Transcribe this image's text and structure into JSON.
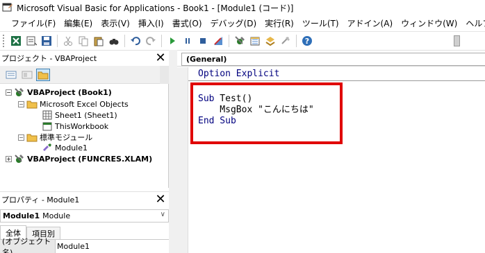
{
  "window": {
    "title": "Microsoft Visual Basic for Applications - Book1 - [Module1 (コード)]"
  },
  "menu": {
    "items": [
      "ファイル(F)",
      "編集(E)",
      "表示(V)",
      "挿入(I)",
      "書式(O)",
      "デバッグ(D)",
      "実行(R)",
      "ツール(T)",
      "アドイン(A)",
      "ウィンドウ(W)",
      "ヘルプ(H)"
    ]
  },
  "toolbar": {
    "icons": [
      "excel-view-icon",
      "insert-module-icon",
      "save-icon",
      "cut-icon",
      "copy-icon",
      "paste-icon",
      "find-icon",
      "undo-icon",
      "redo-icon",
      "run-icon",
      "break-icon",
      "reset-icon",
      "design-mode-icon",
      "project-explorer-icon",
      "properties-icon",
      "object-browser-icon",
      "toolbox-icon",
      "help-icon"
    ]
  },
  "project_pane": {
    "title": "プロジェクト - VBAProject",
    "close_label": "✕",
    "tree": [
      {
        "label": "VBAProject (Book1)",
        "bold": true
      },
      {
        "label": "Microsoft Excel Objects",
        "bold": false
      },
      {
        "label": "Sheet1 (Sheet1)",
        "bold": false
      },
      {
        "label": "ThisWorkbook",
        "bold": false
      },
      {
        "label": "標準モジュール",
        "bold": false
      },
      {
        "label": "Module1",
        "bold": false
      },
      {
        "label": "VBAProject (FUNCRES.XLAM)",
        "bold": true
      }
    ]
  },
  "properties_pane": {
    "title": "プロパティ - Module1",
    "close_label": "✕",
    "object_select": {
      "name": "Module1",
      "type": "Module"
    },
    "tabs": [
      "全体",
      "項目別"
    ],
    "rows": [
      {
        "name": "(オブジェクト名)",
        "value": "Module1"
      }
    ]
  },
  "code_pane": {
    "object_select": "(General)",
    "lines": [
      {
        "text": "Option Explicit",
        "keyword": true
      },
      {
        "text": "",
        "keyword": false
      },
      {
        "text": "Sub Test()",
        "keyword": false
      },
      {
        "text": "    MsgBox \"こんにちは\"",
        "keyword": false
      },
      {
        "text": "End Sub",
        "keyword": true
      }
    ]
  },
  "colors": {
    "highlight": "#e00000",
    "keyword": "#00007f"
  }
}
